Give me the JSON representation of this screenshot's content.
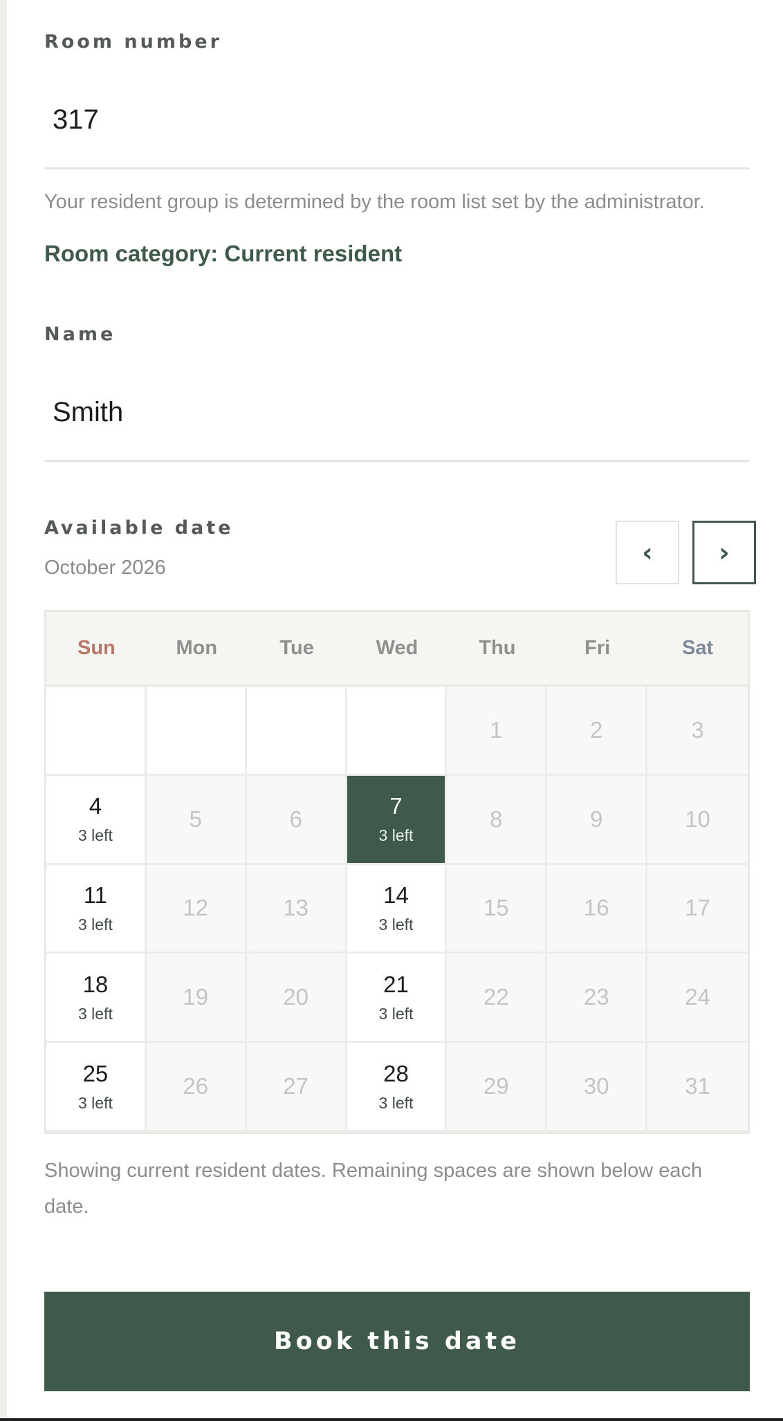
{
  "form": {
    "room_label": "Room number",
    "room_value": "317",
    "room_help": "Your resident group is determined by the room list set by the administrator.",
    "room_category": "Room category: Current resident",
    "name_label": "Name",
    "name_value": "Smith"
  },
  "calendar": {
    "label": "Available date",
    "month": "October 2026",
    "prev_icon": "chevron-left-icon",
    "next_icon": "chevron-right-icon",
    "prev_glyph": "‹",
    "next_glyph": "›",
    "weekdays": [
      "Sun",
      "Mon",
      "Tue",
      "Wed",
      "Thu",
      "Fri",
      "Sat"
    ],
    "cells": [
      {
        "day": "",
        "state": "empty"
      },
      {
        "day": "",
        "state": "empty"
      },
      {
        "day": "",
        "state": "empty"
      },
      {
        "day": "",
        "state": "empty"
      },
      {
        "day": "1",
        "state": "disabled"
      },
      {
        "day": "2",
        "state": "disabled"
      },
      {
        "day": "3",
        "state": "disabled"
      },
      {
        "day": "4",
        "state": "available",
        "remaining": "3 left"
      },
      {
        "day": "5",
        "state": "disabled"
      },
      {
        "day": "6",
        "state": "disabled"
      },
      {
        "day": "7",
        "state": "selected",
        "remaining": "3 left"
      },
      {
        "day": "8",
        "state": "disabled"
      },
      {
        "day": "9",
        "state": "disabled"
      },
      {
        "day": "10",
        "state": "disabled"
      },
      {
        "day": "11",
        "state": "available",
        "remaining": "3 left"
      },
      {
        "day": "12",
        "state": "disabled"
      },
      {
        "day": "13",
        "state": "disabled"
      },
      {
        "day": "14",
        "state": "available",
        "remaining": "3 left"
      },
      {
        "day": "15",
        "state": "disabled"
      },
      {
        "day": "16",
        "state": "disabled"
      },
      {
        "day": "17",
        "state": "disabled"
      },
      {
        "day": "18",
        "state": "available",
        "remaining": "3 left"
      },
      {
        "day": "19",
        "state": "disabled"
      },
      {
        "day": "20",
        "state": "disabled"
      },
      {
        "day": "21",
        "state": "available",
        "remaining": "3 left"
      },
      {
        "day": "22",
        "state": "disabled"
      },
      {
        "day": "23",
        "state": "disabled"
      },
      {
        "day": "24",
        "state": "disabled"
      },
      {
        "day": "25",
        "state": "available",
        "remaining": "3 left"
      },
      {
        "day": "26",
        "state": "disabled"
      },
      {
        "day": "27",
        "state": "disabled"
      },
      {
        "day": "28",
        "state": "available",
        "remaining": "3 left"
      },
      {
        "day": "29",
        "state": "disabled"
      },
      {
        "day": "30",
        "state": "disabled"
      },
      {
        "day": "31",
        "state": "disabled"
      }
    ],
    "note": "Showing current resident dates. Remaining spaces are shown below each date."
  },
  "actions": {
    "book_label": "Book this date"
  },
  "colors": {
    "accent": "#3f5a4a",
    "sunday": "#b7786a",
    "saturday": "#7e8a99"
  }
}
